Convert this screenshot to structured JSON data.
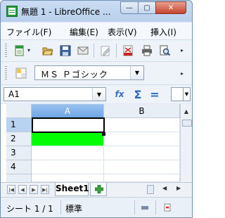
{
  "window": {
    "title": "無題 1 - LibreOffice ...",
    "min_symbol": "—",
    "max_symbol": "▢",
    "close_symbol": "✕"
  },
  "menu": {
    "items": [
      "ファイル(F)",
      "編集(E)",
      "表示(V)",
      "挿入(I)"
    ]
  },
  "toolbar": {
    "buttons": [
      "new-icon",
      "open-icon",
      "save-icon",
      "email-icon",
      "edit-mode-icon",
      "export-pdf-icon",
      "print-icon",
      "print-preview-icon"
    ]
  },
  "format_toolbar": {
    "font_name": "ＭＳ Ｐゴシック"
  },
  "formula_bar": {
    "cell_reference": "A1",
    "function_wizard_label": "fx",
    "sum_label": "Σ",
    "equals_label": "="
  },
  "grid": {
    "columns": [
      "A",
      "B"
    ],
    "selected_column": "A",
    "rows": [
      "1",
      "2",
      "3",
      "4"
    ],
    "active_cell": "A1",
    "fill_color_cell": "A2",
    "fill_color": "#00ff00"
  },
  "sheets": {
    "tabs": [
      "Sheet1"
    ],
    "active": "Sheet1"
  },
  "status": {
    "sheet_info": "シート 1 / 1",
    "page_style": "標準"
  }
}
